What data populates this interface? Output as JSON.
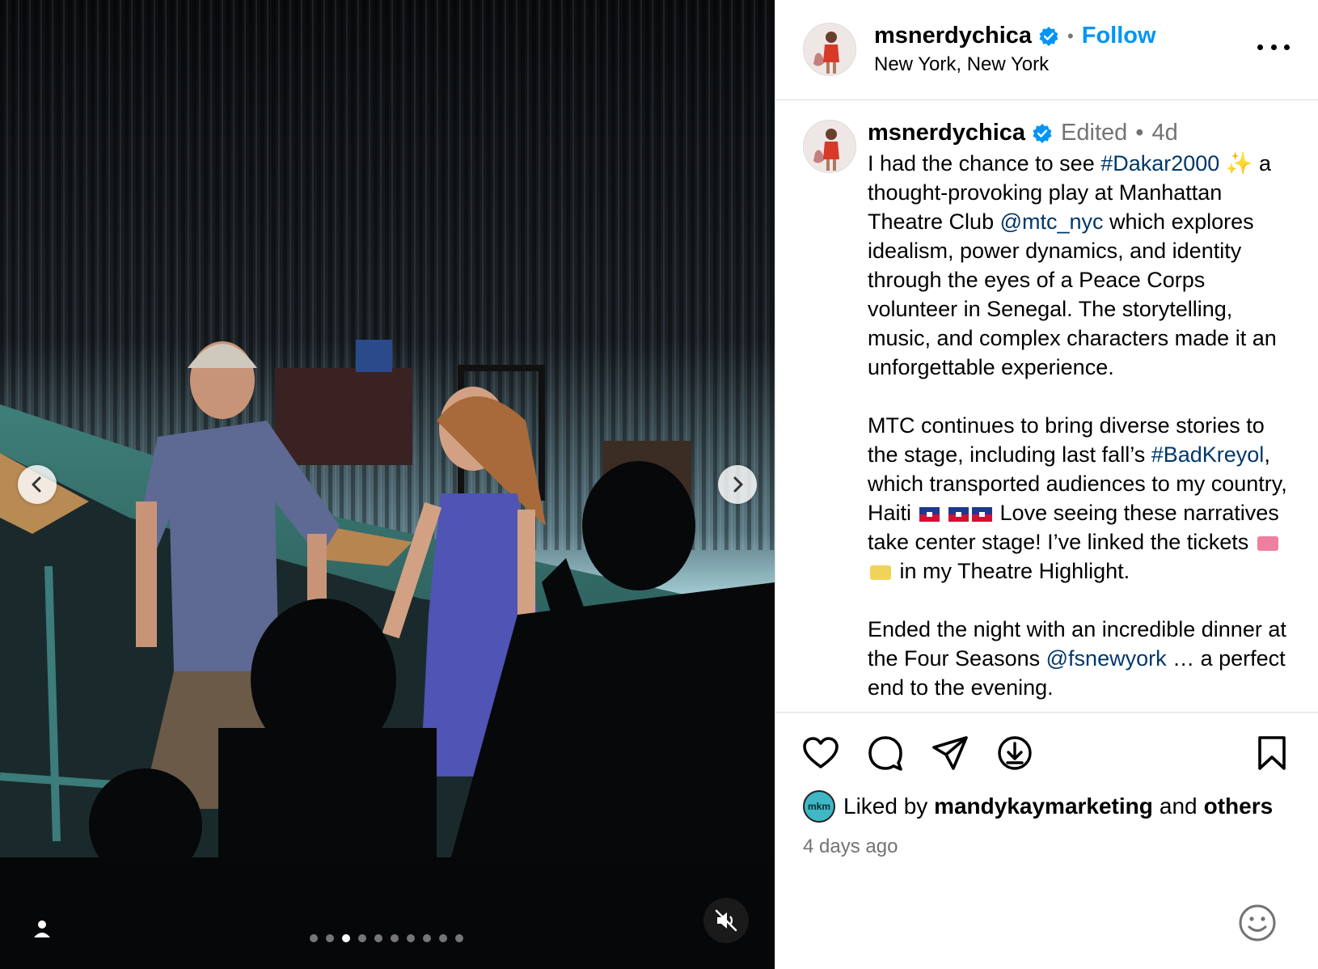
{
  "post": {
    "username": "msnerdychica",
    "follow_label": "Follow",
    "header_separator": "•",
    "location": "New York, New York"
  },
  "caption": {
    "username": "msnerdychica",
    "edited": "Edited",
    "separator": "•",
    "age": "4d",
    "p1_a": "I had the chance to see ",
    "p1_tag": "#Dakar2000",
    "p1_sparkle": "✨",
    "p1_b": " a thought-provoking play at Manhattan Theatre Club ",
    "p1_mention": "@mtc_nyc",
    "p1_c": " which explores idealism, power dynamics, and identity through the eyes of a Peace Corps volunteer in Senegal. The storytelling, music, and complex characters made it an unforgettable experience.",
    "p2_a": "MTC continues to bring diverse stories to the stage, including last fall’s ",
    "p2_tag": "#BadKreyol",
    "p2_b": ", which transported audiences to my country, Haiti ",
    "p2_c": " Love seeing these narratives take center stage! I’ve linked the tickets ",
    "p2_d": " in my Theatre Highlight.",
    "p3_a": "Ended the night with an incredible dinner at the Four Seasons ",
    "p3_mention": "@fsnewyork",
    "p3_b": " … a perfect end to the evening."
  },
  "likes": {
    "avatar_text": "mkm",
    "prefix": "Liked by",
    "user": "mandykaymarketing",
    "middle": "and",
    "others": "others"
  },
  "date": "4 days ago",
  "carousel": {
    "slide_count": 10,
    "active_index": 2
  },
  "icons": {
    "verified": "verified-badge-icon",
    "more": "more-options-icon",
    "like": "heart-icon",
    "comment": "comment-icon",
    "share": "share-icon",
    "save": "bookmark-icon",
    "download": "download-icon",
    "emoji": "emoji-icon",
    "mute": "muted-speaker-icon",
    "tag": "user-tag-icon"
  },
  "colors": {
    "accent": "#0095f6",
    "link": "#00376b",
    "muted": "#737373",
    "divider": "#dbdbdb"
  }
}
